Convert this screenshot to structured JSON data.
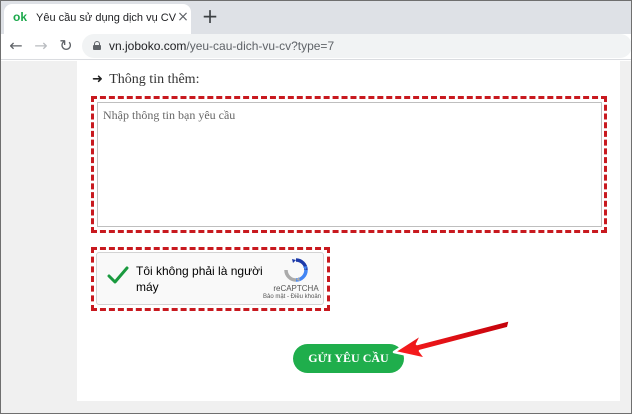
{
  "browser": {
    "tab_favicon": "ok",
    "tab_title": "Yêu cầu sử dụng dịch vụ CV",
    "tab_close": "×",
    "new_tab": "+",
    "url_host": "vn.joboko.com",
    "url_path": "/yeu-cau-dich-vu-cv?type=7"
  },
  "form": {
    "section_title": "Thông tin thêm:",
    "textarea_placeholder": "Nhập thông tin bạn yêu cầu",
    "submit_label": "GỬI YÊU CẦU"
  },
  "recaptcha": {
    "label": "Tôi không phải là người máy",
    "checked": true,
    "brand": "reCAPTCHA",
    "links": "Bảo mật - Điều khoản"
  },
  "colors": {
    "annotation_red": "#c8191f",
    "button_green": "#1fae4c",
    "check_green": "#1a9a3f"
  }
}
